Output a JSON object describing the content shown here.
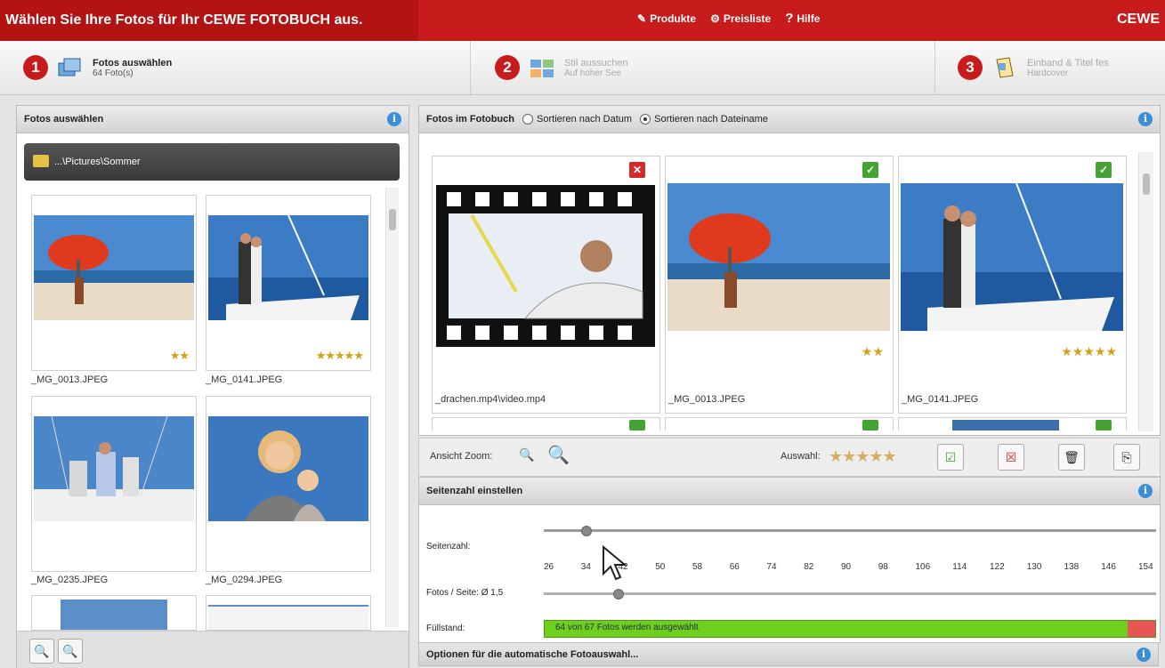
{
  "topbar": {
    "title": "Wählen Sie Ihre Fotos für Ihr CEWE FOTOBUCH aus.",
    "menu": [
      {
        "label": "Produkte",
        "icon": "product-icon"
      },
      {
        "label": "Preisliste",
        "icon": "pricelist-icon"
      },
      {
        "label": "Hilfe",
        "icon": "help-icon"
      }
    ],
    "brand": "CEWE",
    "color": "#c81b1b"
  },
  "steps": [
    {
      "num": "1",
      "title": "Fotos auswählen",
      "sub": "64 Foto(s)",
      "active": true,
      "icon": "photos-icon"
    },
    {
      "num": "2",
      "title": "Stil aussuchen",
      "sub": "Auf hoher See",
      "active": false,
      "icon": "style-icon"
    },
    {
      "num": "3",
      "title": "Einband & Titel fes",
      "sub": "Hardcover",
      "active": false,
      "icon": "cover-icon"
    }
  ],
  "left": {
    "title": "Fotos auswählen",
    "folder": "...\\Pictures\\Sommer",
    "thumbs": [
      {
        "name": "_MG_0013.JPEG",
        "stars": "★★"
      },
      {
        "name": "_MG_0141.JPEG",
        "stars": "★★★★★"
      },
      {
        "name": "_MG_0235.JPEG",
        "stars": ""
      },
      {
        "name": "_MG_0294.JPEG",
        "stars": ""
      }
    ]
  },
  "right": {
    "title": "Fotos im Fotobuch",
    "sort_date": "Sortieren nach Datum",
    "sort_name": "Sortieren nach Dateiname",
    "thumbs": [
      {
        "name": "_drachen.mp4\\video.mp4",
        "stars": "",
        "status": "excluded"
      },
      {
        "name": "_MG_0013.JPEG",
        "stars": "★★",
        "status": "included"
      },
      {
        "name": "_MG_0141.JPEG",
        "stars": "★★★★★",
        "status": "included"
      }
    ]
  },
  "toolbar": {
    "zoom_label": "Ansicht Zoom:",
    "select_label": "Auswahl:",
    "stars": "★★★★★"
  },
  "pages": {
    "title": "Seitenzahl einstellen",
    "count_label": "Seitenzahl:",
    "ticks": [
      "26",
      "34",
      "42",
      "50",
      "58",
      "66",
      "74",
      "82",
      "90",
      "98",
      "106",
      "114",
      "122",
      "130",
      "138",
      "146",
      "154"
    ],
    "photos_per_page": "Fotos / Seite: Ø 1,5",
    "fill_label": "Füllstand:",
    "fill_text": "64 von 67 Fotos werden ausgewählt",
    "fill_fraction": 0.955
  },
  "options_title": "Optionen für die automatische Fotoauswahl..."
}
